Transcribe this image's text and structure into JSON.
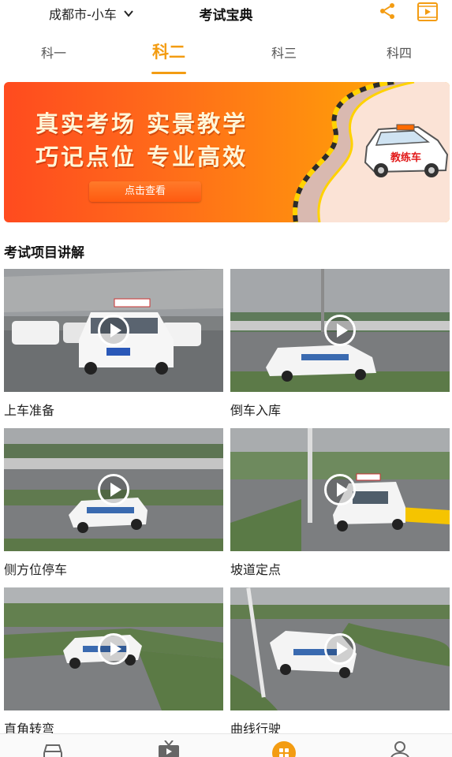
{
  "header": {
    "city": "成都市-小车",
    "title": "考试宝典",
    "share_icon": "share-icon",
    "video_icon": "video-play-icon"
  },
  "tabs": [
    {
      "label": "科一",
      "active": false
    },
    {
      "label": "科二",
      "active": true
    },
    {
      "label": "科三",
      "active": false
    },
    {
      "label": "科四",
      "active": false
    }
  ],
  "banner": {
    "line1": "真实考场 实景教学",
    "line2": "巧记点位 专业高效",
    "button": "点击查看",
    "car_label": "教练车"
  },
  "section": {
    "title": "考试项目讲解"
  },
  "videos": [
    {
      "label": "上车准备"
    },
    {
      "label": "倒车入库"
    },
    {
      "label": "侧方位停车"
    },
    {
      "label": "坡道定点"
    },
    {
      "label": "直角转弯"
    },
    {
      "label": "曲线行驶"
    }
  ],
  "bottom_nav": [
    {
      "icon": "car-icon",
      "active": false
    },
    {
      "icon": "tv-icon",
      "active": false
    },
    {
      "icon": "grid-icon",
      "active": true
    },
    {
      "icon": "user-icon",
      "active": false
    }
  ],
  "colors": {
    "accent": "#f39c12",
    "banner_start": "#ff4b1f",
    "banner_end": "#ffb200"
  }
}
